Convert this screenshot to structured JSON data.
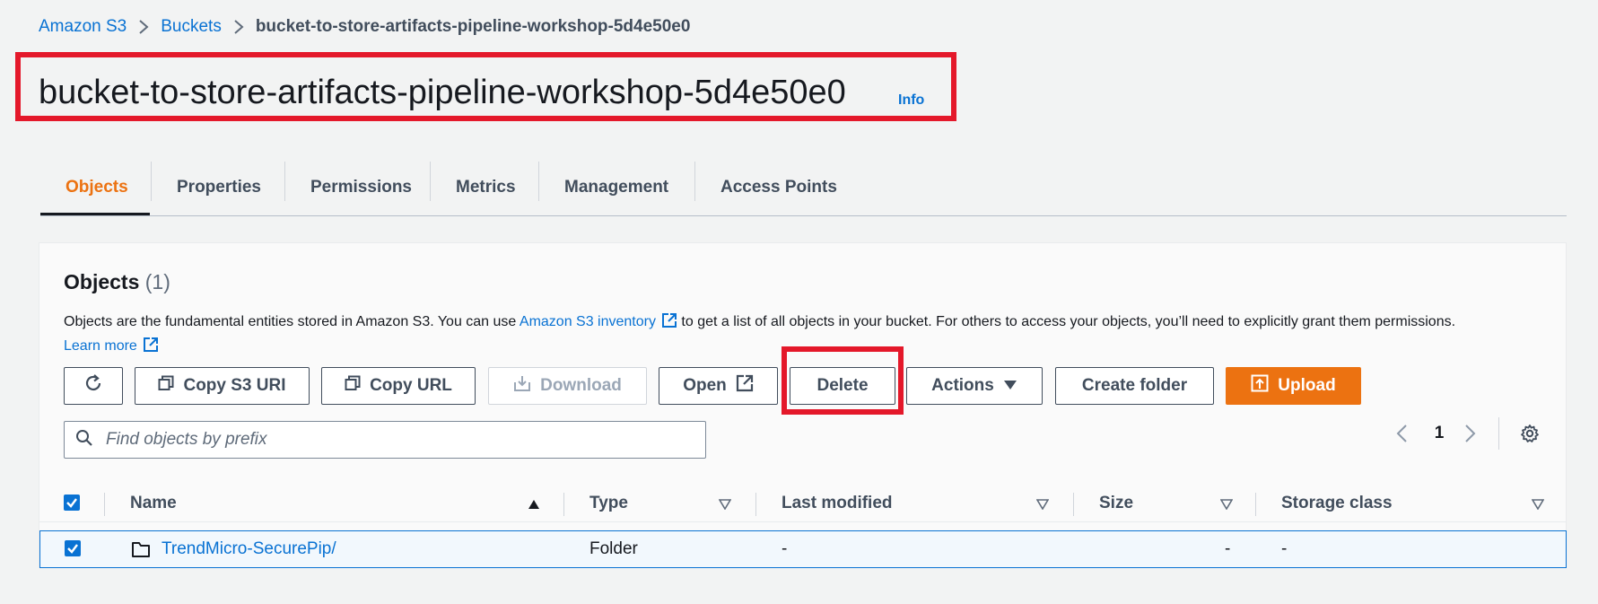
{
  "breadcrumb": {
    "items": [
      "Amazon S3",
      "Buckets"
    ],
    "current": "bucket-to-store-artifacts-pipeline-workshop-5d4e50e0"
  },
  "header": {
    "title": "bucket-to-store-artifacts-pipeline-workshop-5d4e50e0",
    "info": "Info"
  },
  "tabs": [
    {
      "label": "Objects",
      "active": true
    },
    {
      "label": "Properties"
    },
    {
      "label": "Permissions"
    },
    {
      "label": "Metrics"
    },
    {
      "label": "Management"
    },
    {
      "label": "Access Points"
    }
  ],
  "objects": {
    "heading": "Objects",
    "count": "(1)",
    "desc_part1": "Objects are the fundamental entities stored in Amazon S3. You can use ",
    "inventory_link": "Amazon S3 inventory",
    "desc_part2": " to get a list of all objects in your bucket. For others to access your objects, you’ll need to explicitly grant them permissions.",
    "learn_more": "Learn more"
  },
  "toolbar": {
    "copy_s3_uri": "Copy S3 URI",
    "copy_url": "Copy URL",
    "download": "Download",
    "open": "Open",
    "delete": "Delete",
    "actions": "Actions",
    "create_folder": "Create folder",
    "upload": "Upload"
  },
  "search": {
    "placeholder": "Find objects by prefix"
  },
  "pagination": {
    "page": "1"
  },
  "table": {
    "columns": [
      "Name",
      "Type",
      "Last modified",
      "Size",
      "Storage class"
    ],
    "rows": [
      {
        "name": "TrendMicro-SecurePip/",
        "type": "Folder",
        "last_modified": "-",
        "size": "-",
        "storage_class": "-"
      }
    ]
  },
  "colors": {
    "accent": "#ec7211",
    "link": "#0972d3",
    "highlight": "#e4182a"
  }
}
